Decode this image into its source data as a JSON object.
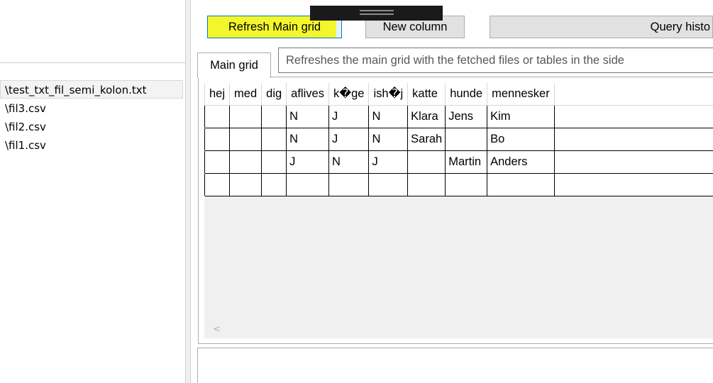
{
  "files": {
    "items": [
      {
        "label": "\\test_txt_fil_semi_kolon.txt",
        "selected": true
      },
      {
        "label": "\\fil3.csv"
      },
      {
        "label": "\\fil2.csv"
      },
      {
        "label": "\\fil1.csv"
      }
    ]
  },
  "toolbar": {
    "refresh_label": "Refresh Main grid",
    "new_column_label": "New column",
    "query_history_label": "Query histo"
  },
  "tabs": {
    "main_label": "Main grid"
  },
  "tooltip": {
    "text": "Refreshes the main grid with the fetched files or tables in the side"
  },
  "grid": {
    "columns": [
      "hej",
      "med",
      "dig",
      "aflives",
      "k�ge",
      "ish�j",
      "katte",
      "hunde",
      "mennesker"
    ],
    "rows": [
      [
        "",
        "",
        "",
        "N",
        "J",
        "N",
        "Klara",
        "Jens",
        "Kim"
      ],
      [
        "",
        "",
        "",
        "N",
        "J",
        "N",
        "Sarah",
        "",
        "Bo"
      ],
      [
        "",
        "",
        "",
        "J",
        "N",
        "J",
        "",
        "Martin",
        "Anders"
      ],
      [
        "",
        "",
        "",
        "",
        "",
        "",
        "",
        "",
        ""
      ]
    ]
  },
  "scrollbar": {
    "left_arrow": "<"
  },
  "colors": {
    "highlight": "#f4f521",
    "focus_border": "#0078d7"
  }
}
